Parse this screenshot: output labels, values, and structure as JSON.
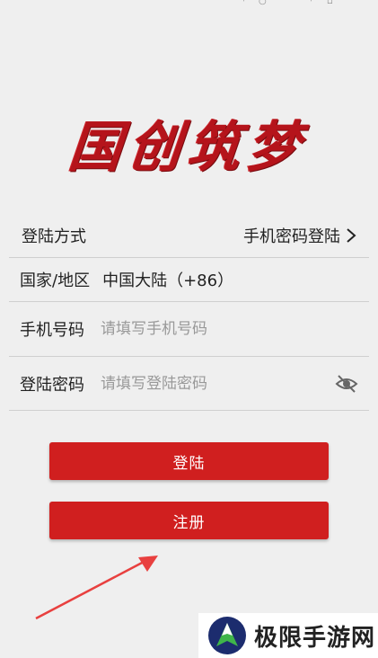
{
  "app": {
    "logo_text": "国创筑梦"
  },
  "form": {
    "method": {
      "label": "登陆方式",
      "value": "手机密码登陆"
    },
    "region": {
      "label": "国家/地区",
      "value": "中国大陆（+86）"
    },
    "phone": {
      "label": "手机号码",
      "placeholder": "请填写手机号码",
      "value": ""
    },
    "password": {
      "label": "登陆密码",
      "placeholder": "请填写登陆密码",
      "value": ""
    }
  },
  "buttons": {
    "login": "登陆",
    "register": "注册"
  },
  "watermark": {
    "text": "极限手游网"
  },
  "colors": {
    "accent": "#d01f1f",
    "logo": "#b5141b",
    "annotation_arrow": "#e8403f",
    "background": "#efefef"
  },
  "icons": {
    "chevron": "chevron-right-icon",
    "password_toggle": "eye-off-icon"
  }
}
